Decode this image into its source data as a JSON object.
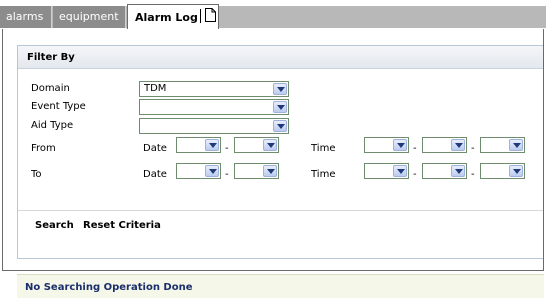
{
  "tabs": {
    "alarms": "alarms",
    "equipment": "equipment",
    "alarm_log": "Alarm Log"
  },
  "filter": {
    "title": "Filter By",
    "domain_label": "Domain",
    "domain_value": "TDM",
    "event_type_label": "Event Type",
    "event_type_value": "",
    "aid_type_label": "Aid Type",
    "aid_type_value": "",
    "from_label": "From",
    "to_label": "To",
    "date_label": "Date",
    "time_label": "Time",
    "separator": "-"
  },
  "actions": {
    "search": "Search",
    "reset": "Reset Criteria"
  },
  "status": {
    "message": "No Searching Operation Done"
  },
  "colors": {
    "tab_inactive": "#8c8c8c",
    "tab_bar": "#b8b8b8",
    "status_text": "#1a2e6b",
    "dropdown_button": "#bccbef"
  },
  "icons": {
    "tab_doc": "document-icon",
    "dropdown": "chevron-down-icon"
  }
}
